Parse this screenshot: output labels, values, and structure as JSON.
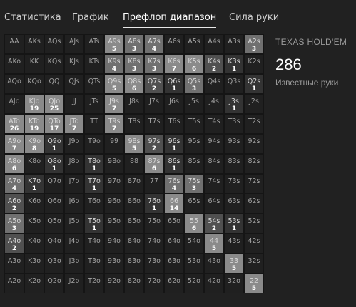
{
  "tabs": [
    {
      "label": "Статистика",
      "active": false
    },
    {
      "label": "График",
      "active": false
    },
    {
      "label": "Префлоп диапазон",
      "active": true
    },
    {
      "label": "Сила руки",
      "active": false
    }
  ],
  "side_panel": {
    "game": "TEXAS HOLD'EM",
    "known_hands": "286",
    "known_hands_label": "Известные руки"
  },
  "colors": {
    "level0": "#202020",
    "level1": "#333333",
    "level2": "#505050",
    "level3": "#707070",
    "level4": "#8a8a8a"
  },
  "grid": {
    "rows": [
      [
        [
          "AA",
          ""
        ],
        [
          "AKs",
          ""
        ],
        [
          "AQs",
          ""
        ],
        [
          "AJs",
          ""
        ],
        [
          "ATs",
          ""
        ],
        [
          "A9s",
          "5"
        ],
        [
          "A8s",
          "3"
        ],
        [
          "A7s",
          "4"
        ],
        [
          "A6s",
          ""
        ],
        [
          "A5s",
          ""
        ],
        [
          "A4s",
          ""
        ],
        [
          "A3s",
          ""
        ],
        [
          "A2s",
          "3"
        ]
      ],
      [
        [
          "AKo",
          ""
        ],
        [
          "KK",
          ""
        ],
        [
          "KQs",
          ""
        ],
        [
          "KJs",
          ""
        ],
        [
          "KTs",
          ""
        ],
        [
          "K9s",
          "4"
        ],
        [
          "K8s",
          "3"
        ],
        [
          "K7s",
          "3"
        ],
        [
          "K6s",
          "7"
        ],
        [
          "K5s",
          "6"
        ],
        [
          "K4s",
          "2"
        ],
        [
          "K3s",
          "1"
        ],
        [
          "K2s",
          ""
        ]
      ],
      [
        [
          "AQo",
          ""
        ],
        [
          "KQo",
          ""
        ],
        [
          "QQ",
          ""
        ],
        [
          "QJs",
          ""
        ],
        [
          "QTs",
          ""
        ],
        [
          "Q9s",
          "5"
        ],
        [
          "Q8s",
          "6"
        ],
        [
          "Q7s",
          "2"
        ],
        [
          "Q6s",
          "1"
        ],
        [
          "Q5s",
          "3"
        ],
        [
          "Q4s",
          ""
        ],
        [
          "Q3s",
          ""
        ],
        [
          "Q2s",
          "1"
        ]
      ],
      [
        [
          "AJo",
          ""
        ],
        [
          "KJo",
          "19"
        ],
        [
          "QJo",
          "25"
        ],
        [
          "JJ",
          ""
        ],
        [
          "JTs",
          ""
        ],
        [
          "J9s",
          "7"
        ],
        [
          "J8s",
          ""
        ],
        [
          "J7s",
          ""
        ],
        [
          "J6s",
          ""
        ],
        [
          "J5s",
          ""
        ],
        [
          "J4s",
          ""
        ],
        [
          "J3s",
          "1"
        ],
        [
          "J2s",
          ""
        ]
      ],
      [
        [
          "ATo",
          "26"
        ],
        [
          "KTo",
          "19"
        ],
        [
          "QTo",
          "17"
        ],
        [
          "JTo",
          "7"
        ],
        [
          "TT",
          ""
        ],
        [
          "T9s",
          "7"
        ],
        [
          "T8s",
          ""
        ],
        [
          "T7s",
          ""
        ],
        [
          "T6s",
          ""
        ],
        [
          "T5s",
          ""
        ],
        [
          "T4s",
          ""
        ],
        [
          "T3s",
          ""
        ],
        [
          "T2s",
          ""
        ]
      ],
      [
        [
          "A9o",
          "7"
        ],
        [
          "K9o",
          "8"
        ],
        [
          "Q9o",
          "1"
        ],
        [
          "J9o",
          ""
        ],
        [
          "T9o",
          ""
        ],
        [
          "99",
          ""
        ],
        [
          "98s",
          "5"
        ],
        [
          "97s",
          "2"
        ],
        [
          "96s",
          "1"
        ],
        [
          "95s",
          ""
        ],
        [
          "94s",
          ""
        ],
        [
          "93s",
          ""
        ],
        [
          "92s",
          ""
        ]
      ],
      [
        [
          "A8o",
          "6"
        ],
        [
          "K8o",
          ""
        ],
        [
          "Q8o",
          "1"
        ],
        [
          "J8o",
          ""
        ],
        [
          "T8o",
          "1"
        ],
        [
          "98o",
          ""
        ],
        [
          "88",
          ""
        ],
        [
          "87s",
          "6"
        ],
        [
          "86s",
          "1"
        ],
        [
          "85s",
          ""
        ],
        [
          "84s",
          ""
        ],
        [
          "83s",
          ""
        ],
        [
          "82s",
          ""
        ]
      ],
      [
        [
          "A7o",
          "4"
        ],
        [
          "K7o",
          "1"
        ],
        [
          "Q7o",
          ""
        ],
        [
          "J7o",
          ""
        ],
        [
          "T7o",
          "1"
        ],
        [
          "97o",
          ""
        ],
        [
          "87o",
          ""
        ],
        [
          "77",
          ""
        ],
        [
          "76s",
          "4"
        ],
        [
          "75s",
          "3"
        ],
        [
          "74s",
          ""
        ],
        [
          "73s",
          ""
        ],
        [
          "72s",
          ""
        ]
      ],
      [
        [
          "A6o",
          "2"
        ],
        [
          "K6o",
          ""
        ],
        [
          "Q6o",
          ""
        ],
        [
          "J6o",
          ""
        ],
        [
          "T6o",
          ""
        ],
        [
          "96o",
          ""
        ],
        [
          "86o",
          ""
        ],
        [
          "76o",
          "1"
        ],
        [
          "66",
          "14"
        ],
        [
          "65s",
          ""
        ],
        [
          "64s",
          ""
        ],
        [
          "63s",
          ""
        ],
        [
          "62s",
          ""
        ]
      ],
      [
        [
          "A5o",
          "3"
        ],
        [
          "K5o",
          ""
        ],
        [
          "Q5o",
          ""
        ],
        [
          "J5o",
          ""
        ],
        [
          "T5o",
          "1"
        ],
        [
          "95o",
          ""
        ],
        [
          "85o",
          ""
        ],
        [
          "75o",
          ""
        ],
        [
          "65o",
          ""
        ],
        [
          "55",
          "6"
        ],
        [
          "54s",
          "2"
        ],
        [
          "53s",
          "1"
        ],
        [
          "52s",
          ""
        ]
      ],
      [
        [
          "A4o",
          "2"
        ],
        [
          "K4o",
          ""
        ],
        [
          "Q4o",
          ""
        ],
        [
          "J4o",
          ""
        ],
        [
          "T4o",
          ""
        ],
        [
          "94o",
          ""
        ],
        [
          "84o",
          ""
        ],
        [
          "74o",
          ""
        ],
        [
          "64o",
          ""
        ],
        [
          "54o",
          ""
        ],
        [
          "44",
          "5"
        ],
        [
          "43s",
          ""
        ],
        [
          "42s",
          ""
        ]
      ],
      [
        [
          "A3o",
          ""
        ],
        [
          "K3o",
          ""
        ],
        [
          "Q3o",
          ""
        ],
        [
          "J3o",
          ""
        ],
        [
          "T3o",
          ""
        ],
        [
          "93o",
          ""
        ],
        [
          "83o",
          ""
        ],
        [
          "73o",
          ""
        ],
        [
          "63o",
          ""
        ],
        [
          "53o",
          ""
        ],
        [
          "43o",
          ""
        ],
        [
          "33",
          "5"
        ],
        [
          "32s",
          ""
        ]
      ],
      [
        [
          "A2o",
          ""
        ],
        [
          "K2o",
          ""
        ],
        [
          "Q2o",
          ""
        ],
        [
          "J2o",
          ""
        ],
        [
          "T2o",
          ""
        ],
        [
          "92o",
          ""
        ],
        [
          "82o",
          ""
        ],
        [
          "72o",
          ""
        ],
        [
          "62o",
          ""
        ],
        [
          "52o",
          ""
        ],
        [
          "42o",
          ""
        ],
        [
          "32o",
          ""
        ],
        [
          "22",
          "5"
        ]
      ]
    ]
  }
}
